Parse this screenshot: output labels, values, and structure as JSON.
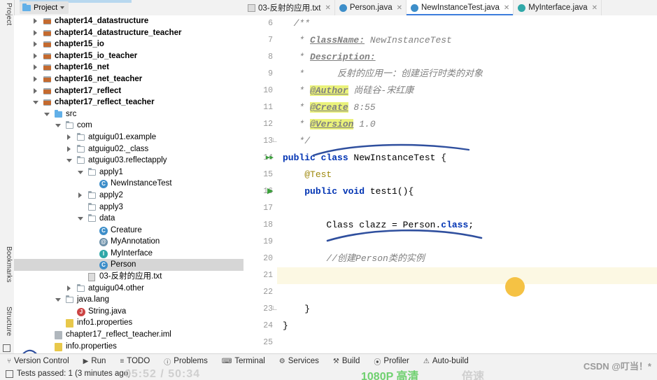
{
  "topbar": {
    "project_label": "Project",
    "icons": [
      "target-icon",
      "collapse-icon",
      "sort-icon",
      "gear-icon",
      "minimize-icon"
    ]
  },
  "left_strip": {
    "tabs": [
      "Project",
      "Bookmarks",
      "Structure"
    ]
  },
  "tree": {
    "items": [
      {
        "indent": 0,
        "arrow": "closed",
        "icon": "module-icon",
        "label": "chapter14_datastructure",
        "bold": true,
        "selected": false
      },
      {
        "indent": 0,
        "arrow": "closed",
        "icon": "module-icon",
        "label": "chapter14_datastructure_teacher",
        "bold": true,
        "selected": false
      },
      {
        "indent": 0,
        "arrow": "closed",
        "icon": "module-icon",
        "label": "chapter15_io",
        "bold": true,
        "selected": false
      },
      {
        "indent": 0,
        "arrow": "closed",
        "icon": "module-icon",
        "label": "chapter15_io_teacher",
        "bold": true,
        "selected": false
      },
      {
        "indent": 0,
        "arrow": "closed",
        "icon": "module-icon",
        "label": "chapter16_net",
        "bold": true,
        "selected": false
      },
      {
        "indent": 0,
        "arrow": "closed",
        "icon": "module-icon",
        "label": "chapter16_net_teacher",
        "bold": true,
        "selected": false
      },
      {
        "indent": 0,
        "arrow": "closed",
        "icon": "module-icon",
        "label": "chapter17_reflect",
        "bold": true,
        "selected": false
      },
      {
        "indent": 0,
        "arrow": "open",
        "icon": "module-icon",
        "label": "chapter17_reflect_teacher",
        "bold": true,
        "selected": false
      },
      {
        "indent": 1,
        "arrow": "open",
        "icon": "source-folder-icon",
        "label": "src",
        "bold": false,
        "selected": false
      },
      {
        "indent": 2,
        "arrow": "open",
        "icon": "folder-icon",
        "label": "com",
        "bold": false,
        "selected": false
      },
      {
        "indent": 3,
        "arrow": "closed",
        "icon": "folder-icon",
        "label": "atguigu01.example",
        "bold": false,
        "selected": false
      },
      {
        "indent": 3,
        "arrow": "closed",
        "icon": "folder-icon",
        "label": "atguigu02._class",
        "bold": false,
        "selected": false
      },
      {
        "indent": 3,
        "arrow": "open",
        "icon": "folder-icon",
        "label": "atguigu03.reflectapply",
        "bold": false,
        "selected": false
      },
      {
        "indent": 4,
        "arrow": "open",
        "icon": "folder-icon",
        "label": "apply1",
        "bold": false,
        "selected": false
      },
      {
        "indent": 5,
        "arrow": "none",
        "icon": "class-icon",
        "label": "NewInstanceTest",
        "bold": false,
        "selected": false
      },
      {
        "indent": 4,
        "arrow": "closed",
        "icon": "folder-icon",
        "label": "apply2",
        "bold": false,
        "selected": false
      },
      {
        "indent": 4,
        "arrow": "none",
        "icon": "folder-icon",
        "label": "apply3",
        "bold": false,
        "selected": false
      },
      {
        "indent": 4,
        "arrow": "open",
        "icon": "folder-icon",
        "label": "data",
        "bold": false,
        "selected": false
      },
      {
        "indent": 5,
        "arrow": "none",
        "icon": "class-icon",
        "label": "Creature",
        "bold": false,
        "selected": false
      },
      {
        "indent": 5,
        "arrow": "none",
        "icon": "annotation-icon",
        "label": "MyAnnotation",
        "bold": false,
        "selected": false
      },
      {
        "indent": 5,
        "arrow": "none",
        "icon": "interface-icon",
        "label": "MyInterface",
        "bold": false,
        "selected": false
      },
      {
        "indent": 5,
        "arrow": "none",
        "icon": "class-icon",
        "label": "Person",
        "bold": false,
        "selected": true
      },
      {
        "indent": 4,
        "arrow": "none",
        "icon": "text-file-icon",
        "label": "03-反射的应用.txt",
        "bold": false,
        "selected": false
      },
      {
        "indent": 3,
        "arrow": "closed",
        "icon": "folder-icon",
        "label": "atguigu04.other",
        "bold": false,
        "selected": false
      },
      {
        "indent": 2,
        "arrow": "open",
        "icon": "folder-icon",
        "label": "java.lang",
        "bold": false,
        "selected": false
      },
      {
        "indent": 3,
        "arrow": "none",
        "icon": "java-file-icon",
        "label": "String.java",
        "bold": false,
        "selected": false
      },
      {
        "indent": 2,
        "arrow": "none",
        "icon": "properties-icon",
        "label": "info1.properties",
        "bold": false,
        "selected": false
      },
      {
        "indent": 1,
        "arrow": "none",
        "icon": "iml-icon",
        "label": "chapter17_reflect_teacher.iml",
        "bold": false,
        "selected": false
      },
      {
        "indent": 1,
        "arrow": "none",
        "icon": "properties-icon",
        "label": "info.properties",
        "bold": false,
        "selected": false
      }
    ]
  },
  "editor_tabs": [
    {
      "icon": "text-file-icon",
      "label": "03-反射的应用.txt",
      "active": false,
      "closable": true
    },
    {
      "icon": "class-icon",
      "label": "Person.java",
      "active": false,
      "closable": true
    },
    {
      "icon": "class-icon",
      "label": "NewInstanceTest.java",
      "active": true,
      "closable": true
    },
    {
      "icon": "interface-icon",
      "label": "MyInterface.java",
      "active": false,
      "closable": true
    }
  ],
  "code": {
    "first_line_number": 6,
    "lines": [
      {
        "n": 6,
        "gutter_mark": "",
        "fold": "",
        "html": "  <span class=\"com\">/**</span>"
      },
      {
        "n": 7,
        "gutter_mark": "",
        "fold": "",
        "html": "   <span class=\"com\">* </span><span class=\"tag\">ClassName:</span><span class=\"com\"> NewInstanceTest</span>"
      },
      {
        "n": 8,
        "gutter_mark": "",
        "fold": "",
        "html": "   <span class=\"com\">* </span><span class=\"tag\">Description:</span>"
      },
      {
        "n": 9,
        "gutter_mark": "",
        "fold": "",
        "html": "   <span class=\"com\">*      反射的应用一：创建运行时类的对象</span>"
      },
      {
        "n": 10,
        "gutter_mark": "",
        "fold": "",
        "html": "   <span class=\"com\">* </span><span class=\"tag-hl\">@Author</span><span class=\"com\"> 尚硅谷-宋红康</span>"
      },
      {
        "n": 11,
        "gutter_mark": "",
        "fold": "",
        "html": "   <span class=\"com\">* </span><span class=\"tag-hl\">@Create</span><span class=\"com\"> 8:55</span>"
      },
      {
        "n": 12,
        "gutter_mark": "",
        "fold": "",
        "html": "   <span class=\"com\">* </span><span class=\"tag-hl\">@Version</span><span class=\"com\"> 1.0</span>"
      },
      {
        "n": 13,
        "gutter_mark": "",
        "fold": "end",
        "html": "   <span class=\"com\">*/</span>"
      },
      {
        "n": 14,
        "gutter_mark": "run-all",
        "fold": "",
        "html": "<span class=\"kw\">public class </span><span class=\"ident\">NewInstanceTest </span>{"
      },
      {
        "n": 15,
        "gutter_mark": "",
        "fold": "",
        "html": "    <span class=\"ann\">@Test</span>"
      },
      {
        "n": 16,
        "gutter_mark": "run",
        "fold": "",
        "html": "    <span class=\"kw\">public void </span><span class=\"ident\">test1</span>(){"
      },
      {
        "n": 17,
        "gutter_mark": "",
        "fold": "",
        "html": ""
      },
      {
        "n": 18,
        "gutter_mark": "",
        "fold": "",
        "html": "        <span class=\"ident\">Class</span> clazz = Person.<span class=\"kw\">class</span>;"
      },
      {
        "n": 19,
        "gutter_mark": "",
        "fold": "",
        "html": ""
      },
      {
        "n": 20,
        "gutter_mark": "",
        "fold": "",
        "html": "        <span class=\"com\">//创建Person类的实例</span>"
      },
      {
        "n": 21,
        "gutter_mark": "",
        "fold": "",
        "html": "",
        "highlight": true
      },
      {
        "n": 22,
        "gutter_mark": "",
        "fold": "",
        "html": ""
      },
      {
        "n": 23,
        "gutter_mark": "",
        "fold": "end",
        "html": "    }"
      },
      {
        "n": 24,
        "gutter_mark": "",
        "fold": "",
        "html": "}"
      },
      {
        "n": 25,
        "gutter_mark": "",
        "fold": "",
        "html": ""
      }
    ]
  },
  "bottom_bar": {
    "items": [
      {
        "icon": "branch-icon",
        "label": "Version Control"
      },
      {
        "icon": "run-icon",
        "label": "Run"
      },
      {
        "icon": "todo-icon",
        "label": "TODO"
      },
      {
        "icon": "problems-icon",
        "label": "Problems"
      },
      {
        "icon": "terminal-icon",
        "label": "Terminal"
      },
      {
        "icon": "services-icon",
        "label": "Services"
      },
      {
        "icon": "build-icon",
        "label": "Build"
      },
      {
        "icon": "profiler-icon",
        "label": "Profiler"
      },
      {
        "icon": "warning-icon",
        "label": "Auto-build"
      }
    ]
  },
  "status_bar": {
    "text": "Tests passed: 1 (3 minutes ago)"
  },
  "overlay": {
    "timecode": "05:52 / 50:34",
    "quality": "1080P 高清",
    "speed": "倍速",
    "csdn": "CSDN @叮当！*"
  },
  "colors": {
    "accent_tab": "#3c7ddc",
    "selection": "#d6d6d6",
    "highlight_line": "#fcf8e3",
    "ink": "#2f4f9e",
    "dot": "#f5c244"
  }
}
